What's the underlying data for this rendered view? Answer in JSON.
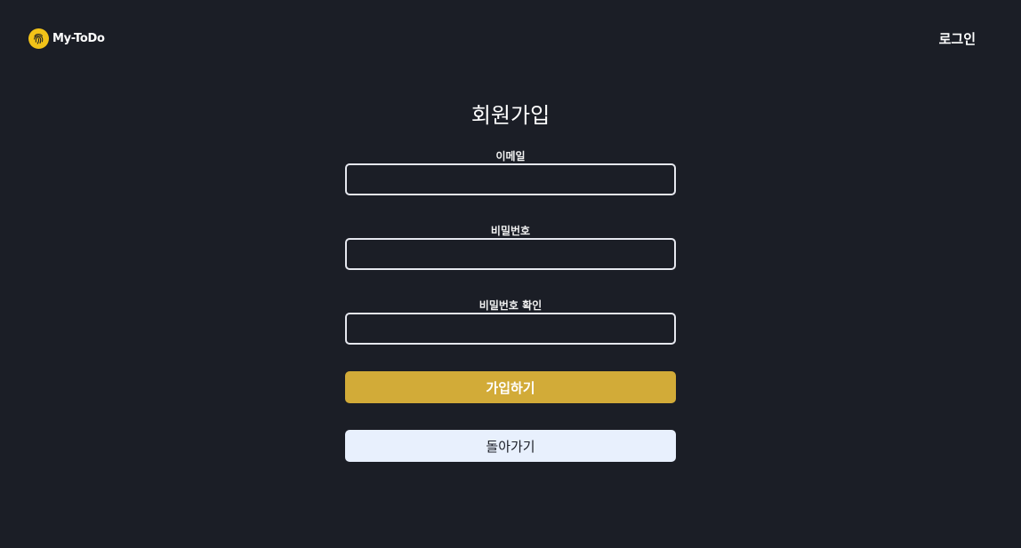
{
  "header": {
    "brand_name": "My-ToDo",
    "logo_icon": "fingerprint-icon",
    "login_label": "로그인"
  },
  "form": {
    "title": "회원가입",
    "email_label": "이메일",
    "email_value": "",
    "password_label": "비밀번호",
    "password_value": "",
    "password_confirm_label": "비밀번호 확인",
    "password_confirm_value": "",
    "submit_label": "가입하기",
    "back_label": "돌아가기"
  },
  "colors": {
    "background": "#1b1e26",
    "accent": "#d2ab38",
    "logo": "#f2c318",
    "secondary_button": "#e8f0fd"
  }
}
